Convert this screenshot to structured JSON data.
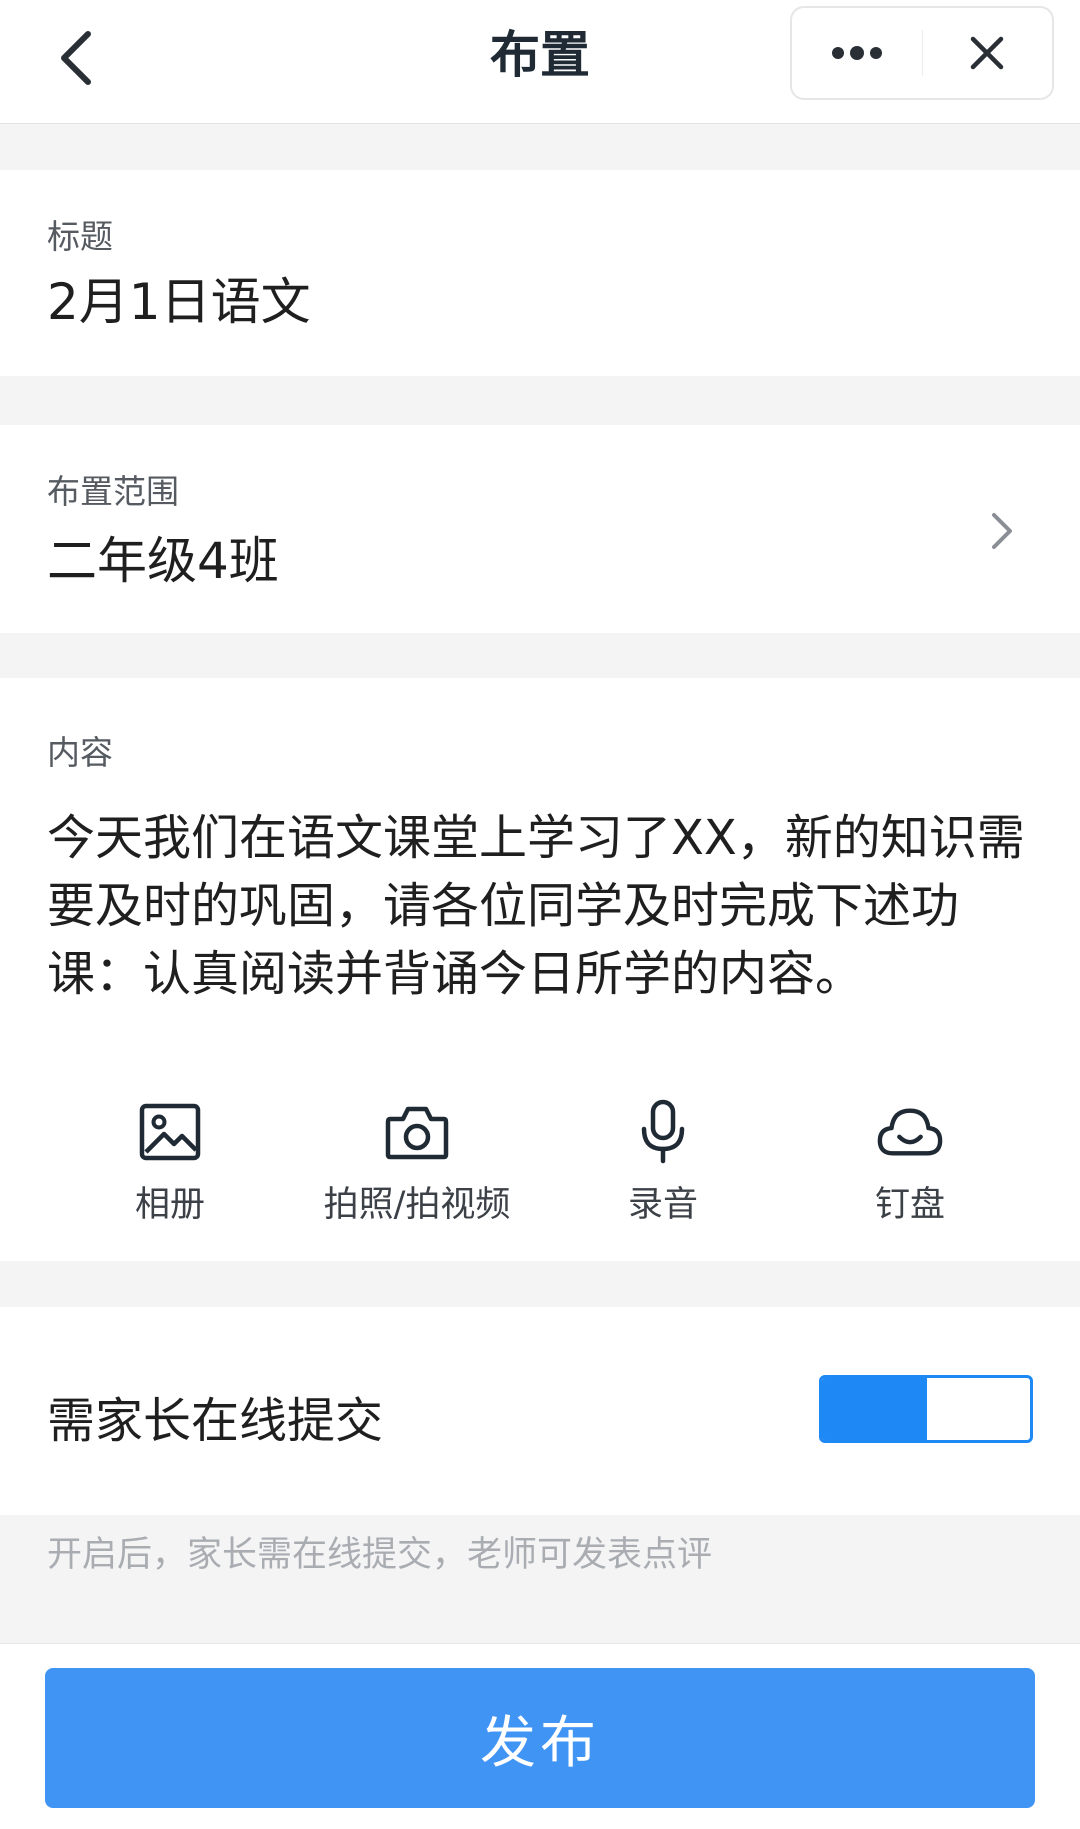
{
  "header": {
    "title": "布置",
    "back_icon": "chevron-left-icon",
    "more_icon": "more-dots-icon",
    "close_icon": "close-icon"
  },
  "title_section": {
    "label": "标题",
    "value": "2月1日语文"
  },
  "range_section": {
    "label": "布置范围",
    "value": "二年级4班",
    "chevron_icon": "chevron-right-icon"
  },
  "content_section": {
    "label": "内容",
    "text": "今天我们在语文课堂上学习了XX，新的知识需要及时的巩固，请各位同学及时完成下述功课：认真阅读并背诵今日所学的内容。",
    "attachments": [
      {
        "label": "相册",
        "icon": "image-icon"
      },
      {
        "label": "拍照/拍视频",
        "icon": "camera-icon"
      },
      {
        "label": "录音",
        "icon": "microphone-icon"
      },
      {
        "label": "钉盘",
        "icon": "cloud-icon"
      }
    ]
  },
  "toggle_section": {
    "label": "需家长在线提交",
    "enabled": true,
    "hint": "开启后，家长需在线提交，老师可发表点评"
  },
  "footer": {
    "publish_label": "发布"
  },
  "colors": {
    "accent": "#1e88f5",
    "publish_button": "#4094f4",
    "background": "#f4f4f5"
  }
}
